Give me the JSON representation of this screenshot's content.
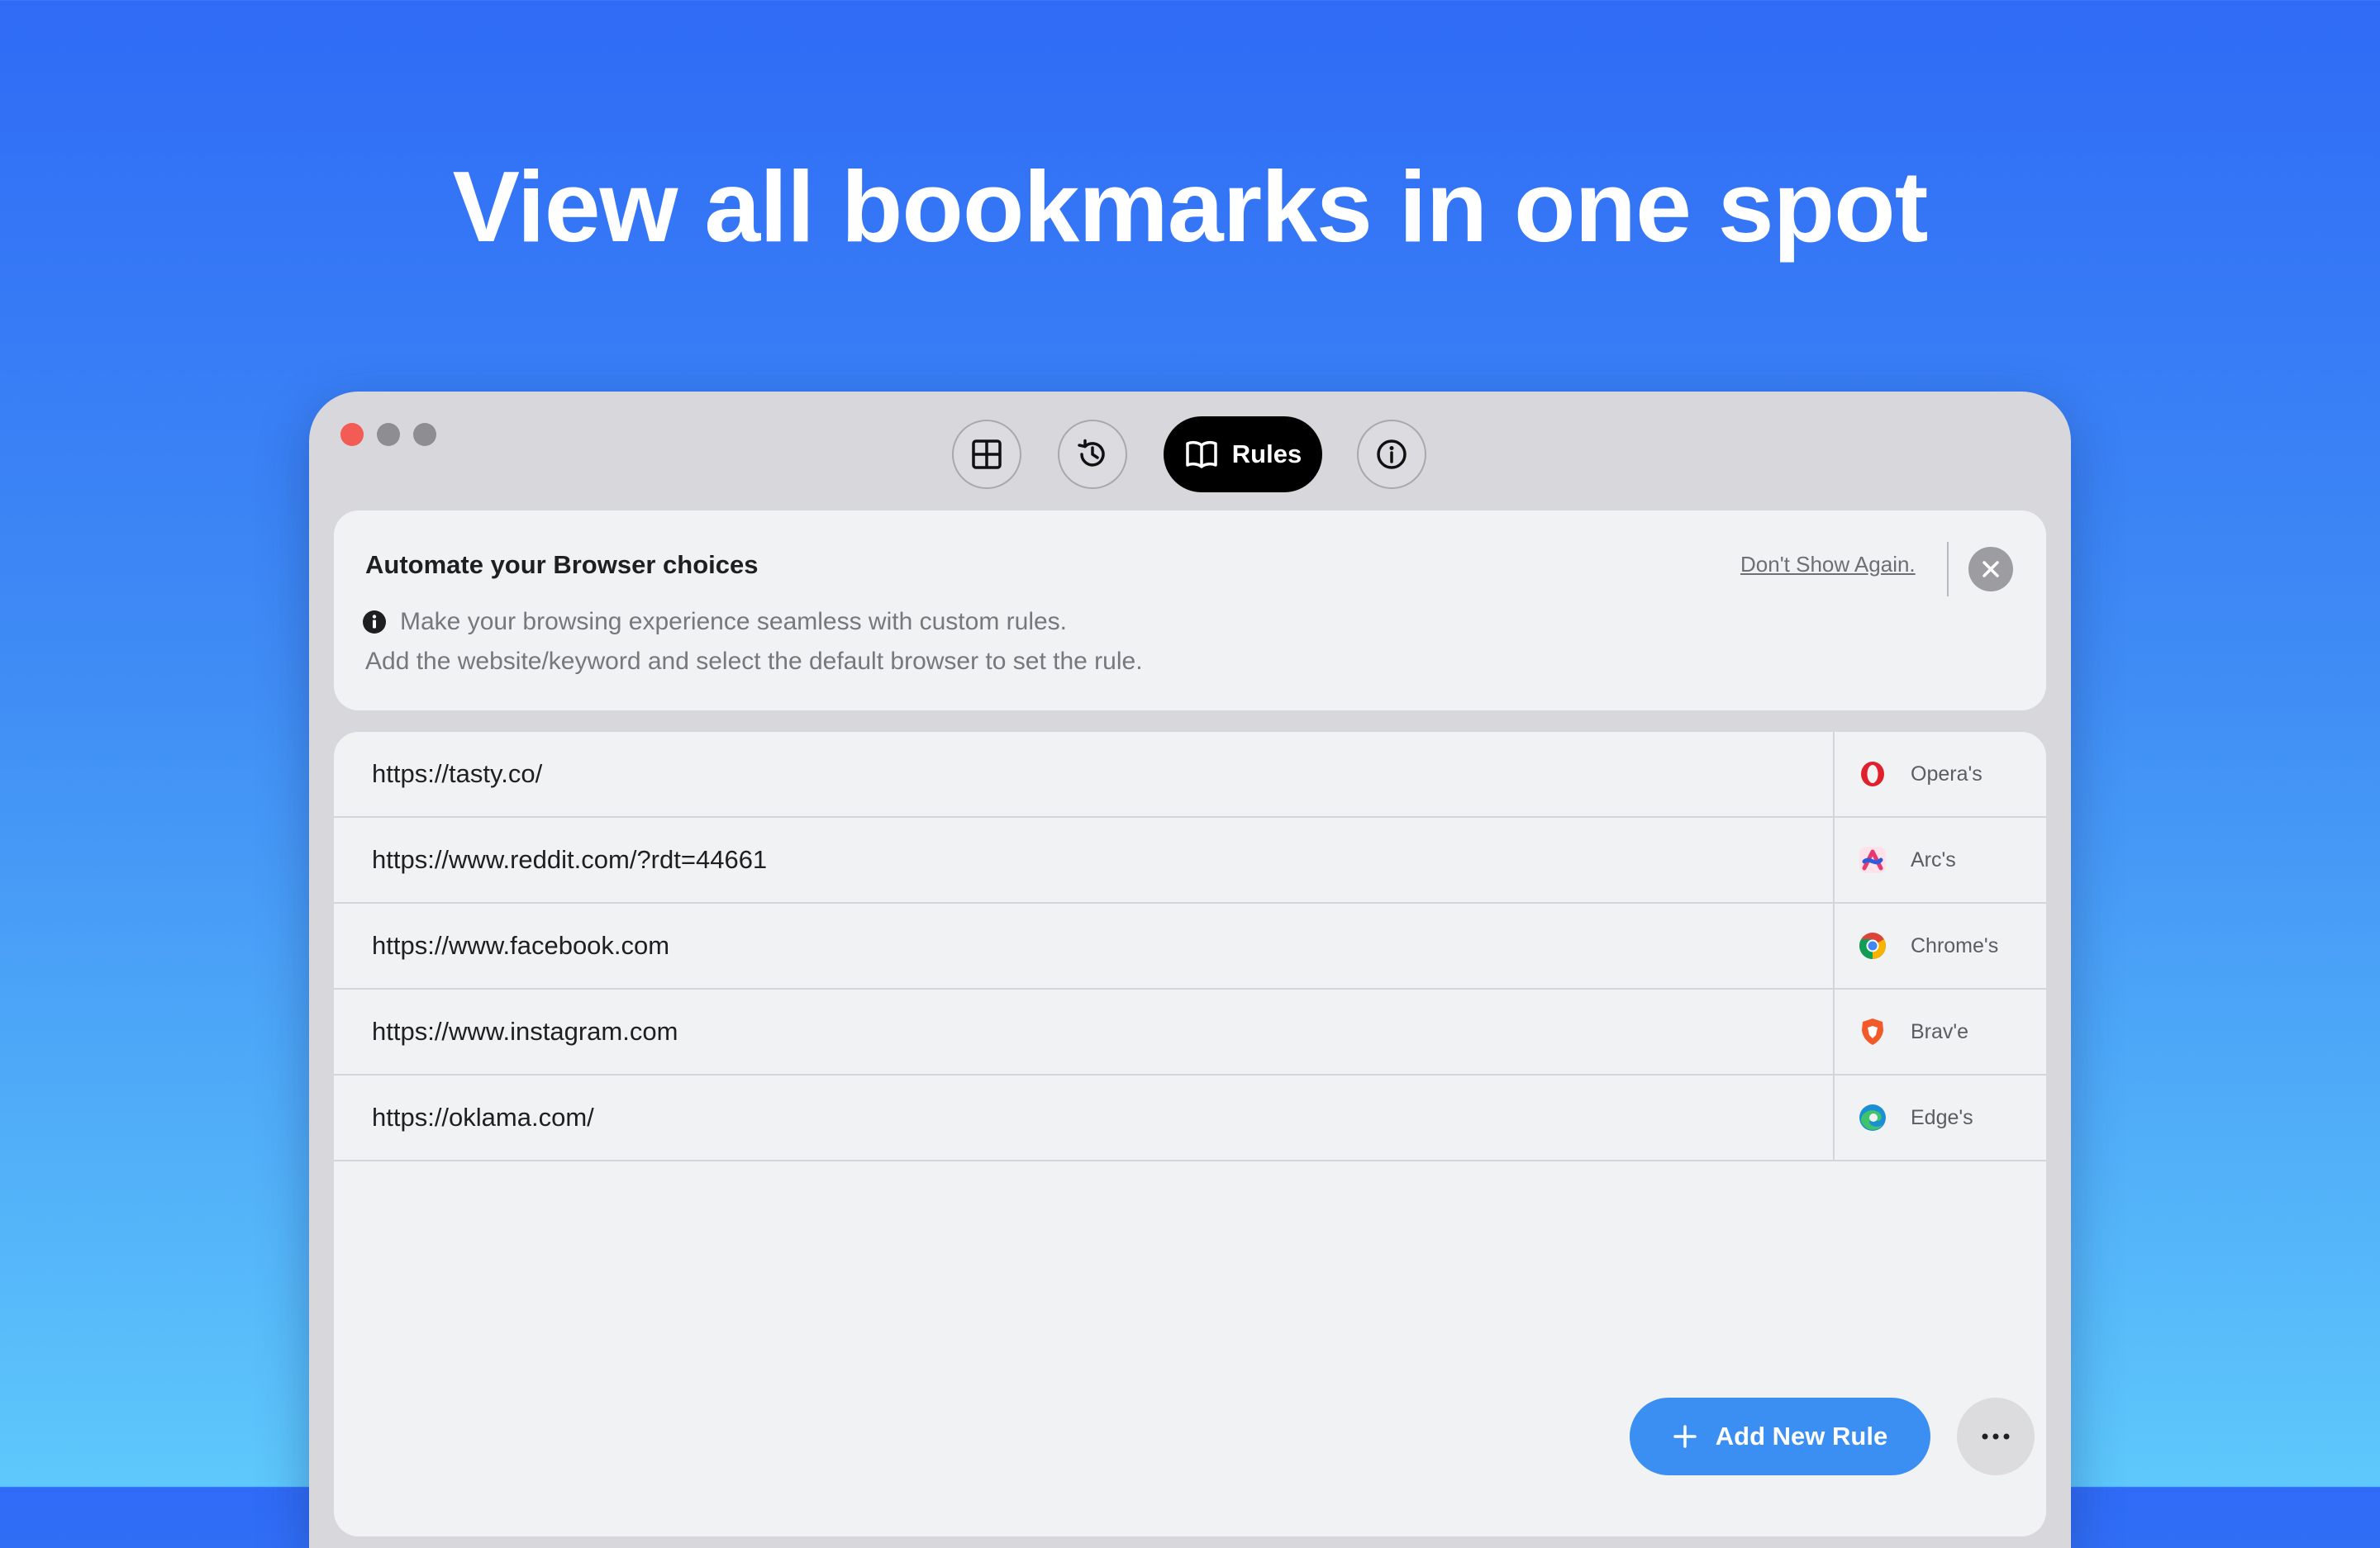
{
  "headline": "View all bookmarks in one spot",
  "toolbar": {
    "rules_label": "Rules"
  },
  "banner": {
    "title": "Automate your Browser choices",
    "line1": "Make your browsing experience seamless with custom rules.",
    "line2": "Add the website/keyword and select the default browser to set the rule.",
    "dont_show": "Don't Show Again."
  },
  "rules": [
    {
      "url": "https://tasty.co/",
      "browser": "Opera's",
      "icon": "opera-icon"
    },
    {
      "url": "https://www.reddit.com/?rdt=44661",
      "browser": "Arc's",
      "icon": "arc-icon"
    },
    {
      "url": "https://www.facebook.com",
      "browser": "Chrome's",
      "icon": "chrome-icon"
    },
    {
      "url": "https://www.instagram.com",
      "browser": "Brav'e",
      "icon": "brave-icon"
    },
    {
      "url": "https://oklama.com/",
      "browser": "Edge's",
      "icon": "edge-icon"
    }
  ],
  "actions": {
    "add_rule_label": "Add New Rule",
    "more_label": "···"
  },
  "colors": {
    "accent": "#3b8ef2",
    "close_red": "#f25c54",
    "active_tab": "#000000"
  }
}
